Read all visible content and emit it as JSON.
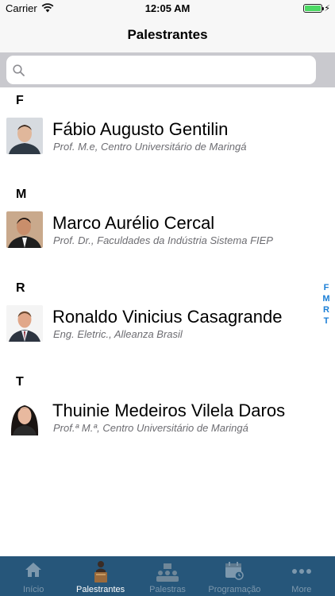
{
  "status_bar": {
    "carrier": "Carrier",
    "time": "12:05 AM"
  },
  "nav": {
    "title": "Palestrantes"
  },
  "search": {
    "placeholder": "",
    "value": ""
  },
  "sections": [
    {
      "letter": "F",
      "name": "Fábio Augusto Gentilin",
      "subtitle": "Prof. M.e, Centro Universitário de Maringá"
    },
    {
      "letter": "M",
      "name": "Marco Aurélio Cercal",
      "subtitle": "Prof. Dr., Faculdades da Indústria Sistema FIEP"
    },
    {
      "letter": "R",
      "name": "Ronaldo Vinicius Casagrande",
      "subtitle": "Eng. Eletric., Alleanza Brasil"
    },
    {
      "letter": "T",
      "name": "Thuinie Medeiros Vilela Daros",
      "subtitle": "Prof.ª M.ª, Centro Universitário de Maringá"
    }
  ],
  "index_letters": [
    "F",
    "M",
    "R",
    "T"
  ],
  "tabs": [
    {
      "label": "Início",
      "icon": "home-icon",
      "active": false
    },
    {
      "label": "Palestrantes",
      "icon": "speaker-icon",
      "active": true
    },
    {
      "label": "Palestras",
      "icon": "audience-icon",
      "active": false
    },
    {
      "label": "Programação",
      "icon": "calendar-icon",
      "active": false
    },
    {
      "label": "More",
      "icon": "more-icon",
      "active": false
    }
  ],
  "colors": {
    "tab_bar": "#26567a",
    "index_accent": "#1a7ed6",
    "battery": "#4cd964"
  }
}
